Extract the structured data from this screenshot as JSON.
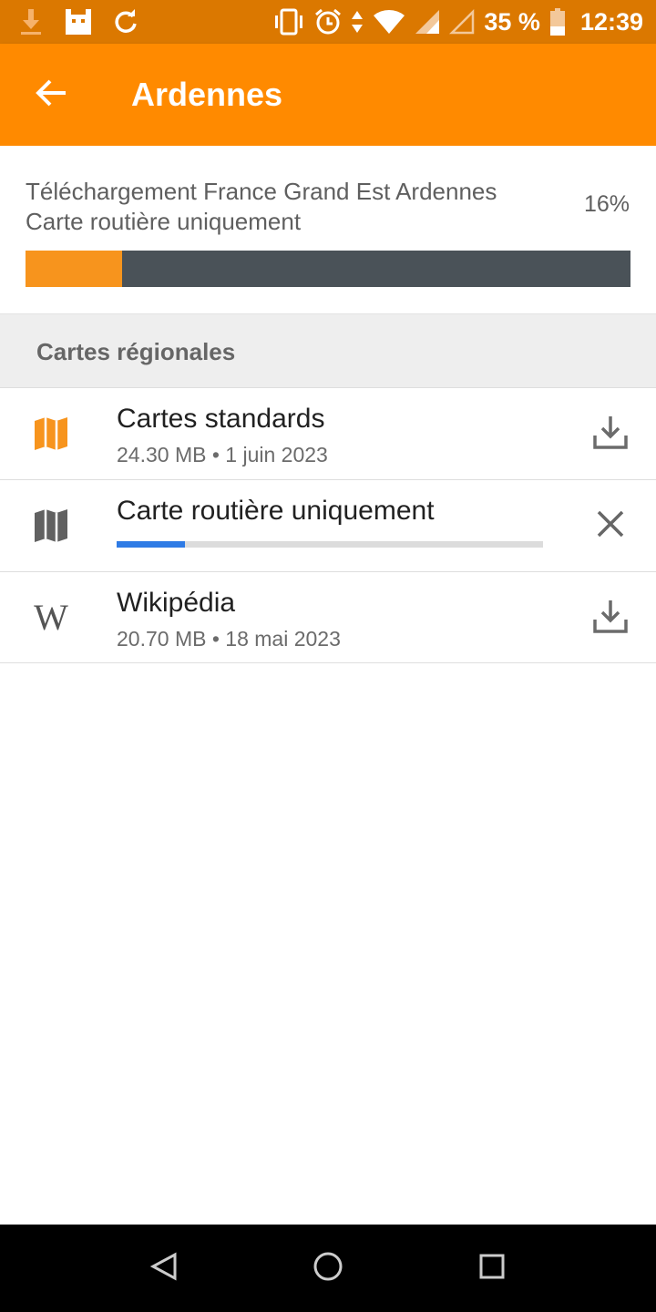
{
  "status_bar": {
    "battery_percent": "35 %",
    "time": "12:39",
    "icons_left": [
      "download-notification-icon",
      "android-app-icon",
      "sync-icon"
    ],
    "icons_right": [
      "vibrate-icon",
      "alarm-icon",
      "data-arrows-icon",
      "wifi-icon",
      "signal-icon",
      "signal-empty-icon",
      "battery-icon"
    ]
  },
  "app_bar": {
    "title": "Ardennes",
    "back_icon": "arrow-back-icon",
    "background_color": "#ff8a00"
  },
  "download": {
    "line1": "Téléchargement France Grand Est Ardennes",
    "line2": "Carte routière uniquement",
    "percent_label": "16%",
    "progress": 0.16,
    "fill_color": "#f7941d",
    "track_color": "#4a5258"
  },
  "section": {
    "title": "Cartes régionales"
  },
  "items": [
    {
      "title": "Cartes standards",
      "subtitle": "24.30 MB • 1 juin 2023",
      "icon": "map-icon",
      "icon_color": "#f7941d",
      "action": "download-icon"
    },
    {
      "title": "Carte routière uniquement",
      "progress": 0.16,
      "progress_color": "#2f7be5",
      "icon": "map-icon",
      "icon_color": "#616161",
      "action": "close-icon"
    },
    {
      "title": "Wikipédia",
      "subtitle": "20.70 MB • 18 mai 2023",
      "icon": "wikipedia-icon",
      "icon_glyph": "W",
      "action": "download-icon"
    }
  ],
  "nav_bar": {
    "buttons": [
      "back-triangle-icon",
      "home-circle-icon",
      "recents-square-icon"
    ]
  }
}
